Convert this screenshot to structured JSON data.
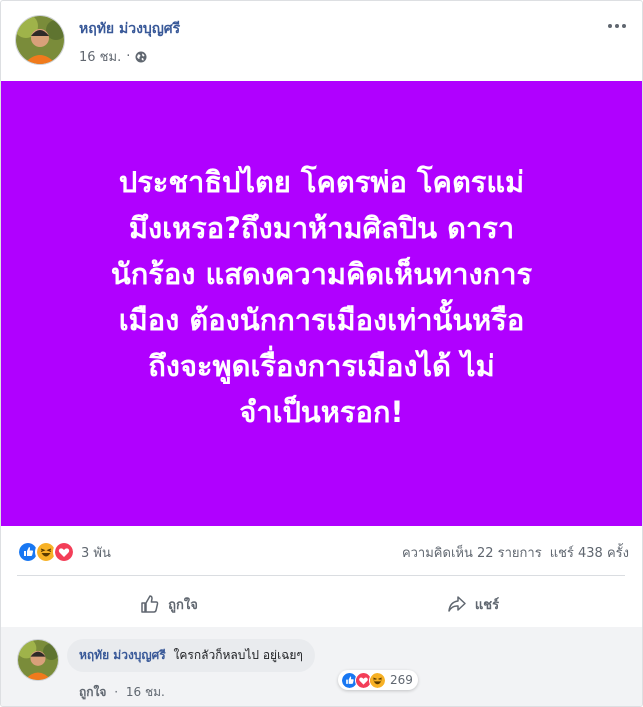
{
  "post": {
    "author": "หฤทัย ม่วงบุญศรี",
    "time": "16 ชม.",
    "separator": "·",
    "privacy_icon": "globe-icon",
    "background_color": "#b000ff",
    "text_lines": [
      "ประชาธิปไตย โคตรพ่อ โคตรแม่",
      "มึงเหรอ?ถึงมาห้ามศิลปิน ดารา",
      "นักร้อง แสดงความคิดเห็นทางการ",
      "เมือง ต้องนักการเมืองเท่านั้นหรือ",
      "ถึงจะพูดเรื่องการเมืองได้ ไม่",
      "จำเป็นหรอก!"
    ]
  },
  "reactions": {
    "icons": [
      "like-icon",
      "haha-icon",
      "love-icon"
    ],
    "count": "3 พัน",
    "comments_count": "ความคิดเห็น 22 รายการ",
    "shares_count": "แชร์ 438 ครั้ง"
  },
  "actions": {
    "like_label": "ถูกใจ",
    "share_label": "แชร์"
  },
  "comment": {
    "author": "หฤทัย ม่วงบุญศรี",
    "text": "ใครกลัวก็หลบไป อยู่เฉยๆ",
    "reaction_icons": [
      "like-icon",
      "love-icon",
      "haha-icon"
    ],
    "reaction_count": "269",
    "like_label": "ถูกใจ",
    "separator": "·",
    "time": "16 ชม."
  },
  "colors": {
    "link_blue": "#385898",
    "like_blue": "#1877f2",
    "love_red": "#f33e58",
    "haha_yellow": "#f7b125"
  }
}
